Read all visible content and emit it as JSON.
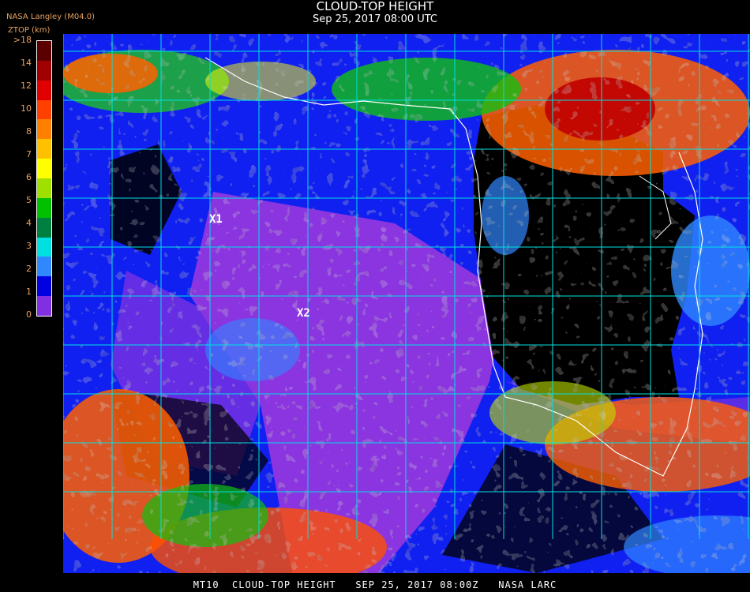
{
  "title": "CLOUD-TOP HEIGHT",
  "subtitle": "Sep 25, 2017 08:00 UTC",
  "producer": "NASA Langley (M04.0)",
  "units_label": "ZTOP (km)",
  "legend": {
    "ticks": [
      ">18",
      "14",
      "12",
      "10",
      "8",
      "7",
      "6",
      "5",
      "4",
      "3",
      "2",
      "1",
      "0"
    ],
    "colors": [
      "#5a0000",
      "#a00000",
      "#e00000",
      "#ff4000",
      "#ff8000",
      "#ffc000",
      "#ffff00",
      "#a0e000",
      "#00c000",
      "#008040",
      "#00e0e0",
      "#3088ff",
      "#0000e0",
      "#8030e0"
    ]
  },
  "markers": [
    {
      "label": "X1"
    },
    {
      "label": "X2"
    }
  ],
  "colors": {
    "background": "#000000",
    "grid": "#00e0e0",
    "coast": "#ffffff",
    "low_cloud": "#8a35e0",
    "mid_cloud": "#1020f0",
    "water": "#000000"
  },
  "footer": "MT10  CLOUD-TOP HEIGHT   SEP 25, 2017 08:00Z   NASA LARC"
}
